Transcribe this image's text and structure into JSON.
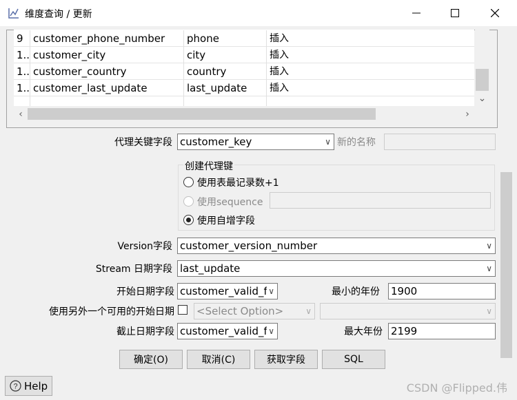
{
  "window": {
    "title": "维度查询 / 更新",
    "minimize_icon": "minimize-icon",
    "maximize_icon": "maximize-icon",
    "close_icon": "close-icon"
  },
  "table": {
    "rows": [
      {
        "num": "9",
        "field": "customer_phone_number",
        "stream": "phone",
        "type": "插入"
      },
      {
        "num": "1..",
        "field": "customer_city",
        "stream": "city",
        "type": "插入"
      },
      {
        "num": "1..",
        "field": "customer_country",
        "stream": "country",
        "type": "插入"
      },
      {
        "num": "1..",
        "field": "customer_last_update",
        "stream": "last_update",
        "type": "插入"
      }
    ]
  },
  "surrogate": {
    "label": "代理关键字段",
    "value": "customer_key",
    "newname_label": "新的名称",
    "newname_value": ""
  },
  "create_key": {
    "legend": "创建代理键",
    "option1": "使用表最记录数+1",
    "option2": "使用sequence",
    "option3": "使用自增字段",
    "sequence_value": ""
  },
  "version": {
    "label": "Version字段",
    "value": "customer_version_number"
  },
  "stream_date": {
    "label": "Stream 日期字段",
    "value": "last_update"
  },
  "start_date": {
    "label": "开始日期字段",
    "value": "customer_valid_f",
    "min_year_label": "最小的年份",
    "min_year": "1900"
  },
  "alt_start": {
    "label": "使用另外一个可用的开始日期",
    "select_placeholder": "<Select Option>",
    "select2_value": ""
  },
  "end_date": {
    "label": "截止日期字段",
    "value": "customer_valid_f",
    "max_year_label": "最大年份",
    "max_year": "2199"
  },
  "buttons": {
    "ok": "确定(O)",
    "cancel": "取消(C)",
    "get_fields": "获取字段",
    "sql": "SQL"
  },
  "help": {
    "label": "Help",
    "icon": "help-icon"
  },
  "watermark": "CSDN @Flipped.伟"
}
